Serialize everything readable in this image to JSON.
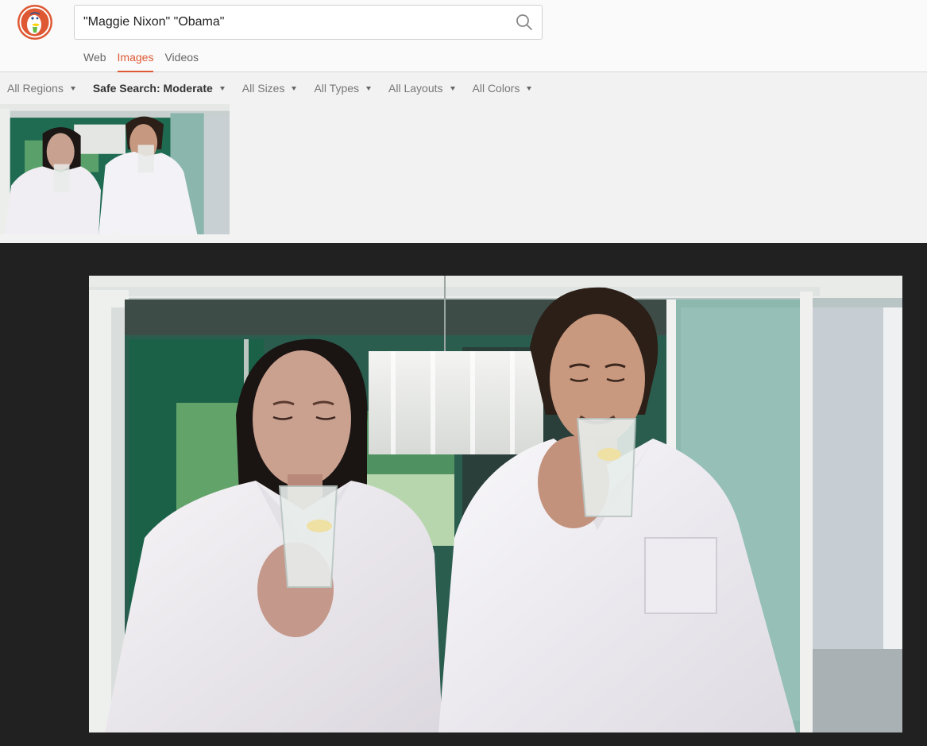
{
  "search": {
    "query": "\"Maggie Nixon\" \"Obama\""
  },
  "tabs": [
    {
      "label": "Web",
      "active": false
    },
    {
      "label": "Images",
      "active": true
    },
    {
      "label": "Videos",
      "active": false
    }
  ],
  "filters": [
    {
      "label": "All Regions"
    },
    {
      "label": "Safe Search: Moderate"
    },
    {
      "label": "All Sizes"
    },
    {
      "label": "All Types"
    },
    {
      "label": "All Layouts"
    },
    {
      "label": "All Colors"
    }
  ],
  "icons": {
    "logo": "duckduckgo-logo",
    "search": "search-icon",
    "dropdown": "caret-down-icon"
  },
  "colors": {
    "accent": "#de5833",
    "detail_background": "#212121"
  }
}
